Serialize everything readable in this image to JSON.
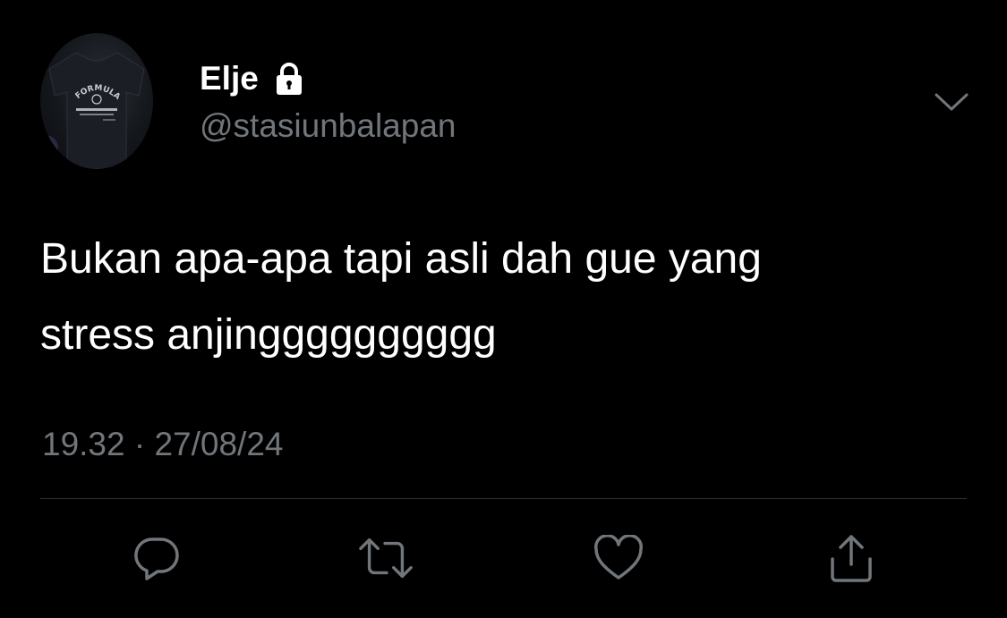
{
  "user": {
    "display_name": "Elje",
    "handle": "@stasiunbalapan",
    "protected_icon": "lock-icon",
    "avatar_text": "FORMULA 1"
  },
  "tweet": {
    "text_line1": "Bukan apa-apa tapi asli dah gue yang",
    "text_line2": "stress anjingggggggggg",
    "timestamp": "19.32 · 27/08/24"
  },
  "actions": [
    {
      "icon": "reply-icon"
    },
    {
      "icon": "retweet-icon"
    },
    {
      "icon": "like-icon"
    },
    {
      "icon": "share-icon"
    }
  ],
  "menu": {
    "icon": "chevron-down-icon"
  },
  "colors": {
    "background": "#000000",
    "text_primary": "#ffffff",
    "text_secondary": "#71767b",
    "icon": "#71767b",
    "divider": "#2f3336"
  }
}
